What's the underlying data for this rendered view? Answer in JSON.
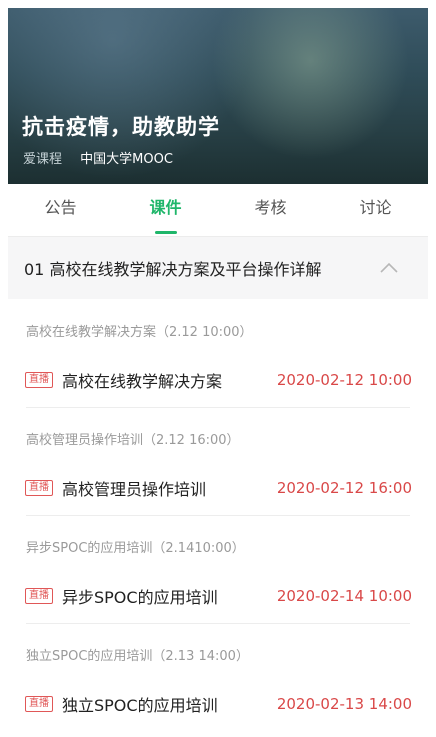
{
  "hero": {
    "title": "抗击疫情，助教助学",
    "tag": "爱课程",
    "school": "中国大学MOOC"
  },
  "tabs": [
    {
      "label": "公告",
      "active": false
    },
    {
      "label": "课件",
      "active": true
    },
    {
      "label": "考核",
      "active": false
    },
    {
      "label": "讨论",
      "active": false
    }
  ],
  "chapter": {
    "title": "01 高校在线教学解决方案及平台操作详解",
    "expanded": true,
    "icon": "chevron-up-icon"
  },
  "sections": [
    {
      "header": "高校在线教学解决方案（2.12 10:00）",
      "badge": "直播",
      "title": "高校在线教学解决方案",
      "time": "2020-02-12 10:00"
    },
    {
      "header": "高校管理员操作培训（2.12 16:00）",
      "badge": "直播",
      "title": "高校管理员操作培训",
      "time": "2020-02-12 16:00"
    },
    {
      "header": "异步SPOC的应用培训（2.1410:00）",
      "badge": "直播",
      "title": "异步SPOC的应用培训",
      "time": "2020-02-14 10:00"
    },
    {
      "header": "独立SPOC的应用培训（2.13 14:00）",
      "badge": "直播",
      "title": "独立SPOC的应用培训",
      "time": "2020-02-13 14:00"
    }
  ],
  "colors": {
    "accent": "#1fb66a",
    "live_red": "#d94848",
    "chapter_bg": "#f6f6f7"
  }
}
